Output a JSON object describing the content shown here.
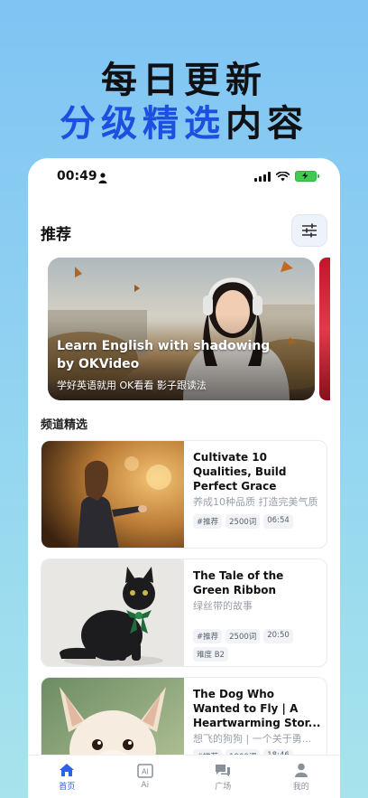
{
  "hero": {
    "line1": "每日更新",
    "line2_blue": "分级精选",
    "line2_dark": "内容"
  },
  "status": {
    "time": "00:49"
  },
  "recommend": {
    "title": "推荐",
    "banner_title": "Learn English with shadowing by OKVideo",
    "banner_sub": "学好英语就用 OK看看 影子跟读法"
  },
  "channel": {
    "title": "频道精选",
    "cards": [
      {
        "title": "Cultivate 10 Qualities, Build Perfect Grace",
        "subtitle": "养成10种品质 打造完美气质",
        "tags": [
          "#推荐",
          "2500词",
          "06:54"
        ]
      },
      {
        "title": "The Tale of the Green Ribbon",
        "subtitle": "绿丝带的故事",
        "tags": [
          "#推荐",
          "2500词",
          "20:50",
          "难度 B2"
        ]
      },
      {
        "title": "The Dog Who Wanted to Fly | A Heartwarming Stor...",
        "subtitle": "想飞的狗狗 | 一个关于勇...",
        "tags": [
          "#推荐",
          "1900词",
          "18:46"
        ]
      }
    ]
  },
  "tabbar": {
    "items": [
      {
        "label": "首页",
        "icon": "home-icon"
      },
      {
        "label": "Ai",
        "icon": "ai-icon"
      },
      {
        "label": "广场",
        "icon": "chat-icon"
      },
      {
        "label": "我的",
        "icon": "profile-icon"
      }
    ]
  },
  "colors": {
    "accent": "#1d4fe0",
    "tab_active": "#2a62e8"
  }
}
